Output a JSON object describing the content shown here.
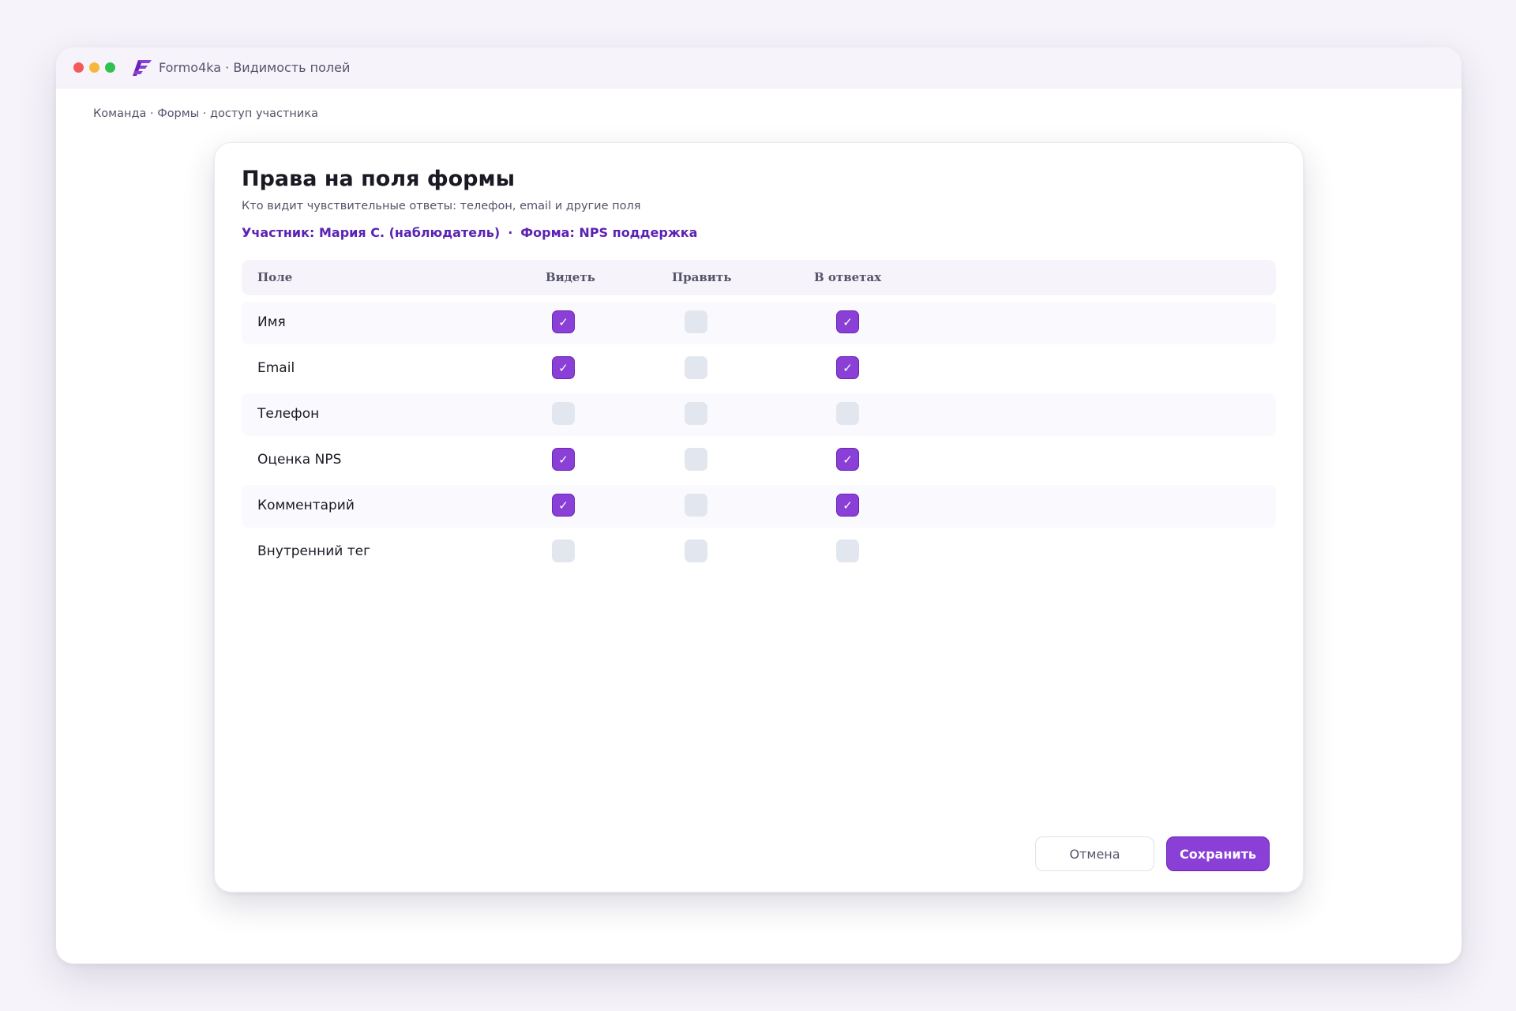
{
  "window": {
    "app_title": "Formo4ka · Видимость полей",
    "brand_color": "#8a3fd6"
  },
  "breadcrumb": "Команда · Формы · доступ участника",
  "dialog": {
    "title": "Права на поля формы",
    "subtitle": "Кто видит чувствительные ответы: телефон, email и другие поля",
    "participant": "Участник: Мария С. (наблюдатель)",
    "separator": "·",
    "form": "Форма: NPS поддержка"
  },
  "table": {
    "headers": {
      "field": "Поле",
      "view": "Видеть",
      "edit": "Править",
      "in_responses": "В ответах"
    },
    "rows": [
      {
        "label": "Имя",
        "view": true,
        "edit": false,
        "in_responses": true
      },
      {
        "label": "Email",
        "view": true,
        "edit": false,
        "in_responses": true
      },
      {
        "label": "Телефон",
        "view": false,
        "edit": false,
        "in_responses": false
      },
      {
        "label": "Оценка NPS",
        "view": true,
        "edit": false,
        "in_responses": true
      },
      {
        "label": "Комментарий",
        "view": true,
        "edit": false,
        "in_responses": true
      },
      {
        "label": "Внутренний тег",
        "view": false,
        "edit": false,
        "in_responses": false
      }
    ],
    "check_glyph": "✓"
  },
  "buttons": {
    "cancel": "Отмена",
    "save": "Сохранить"
  }
}
